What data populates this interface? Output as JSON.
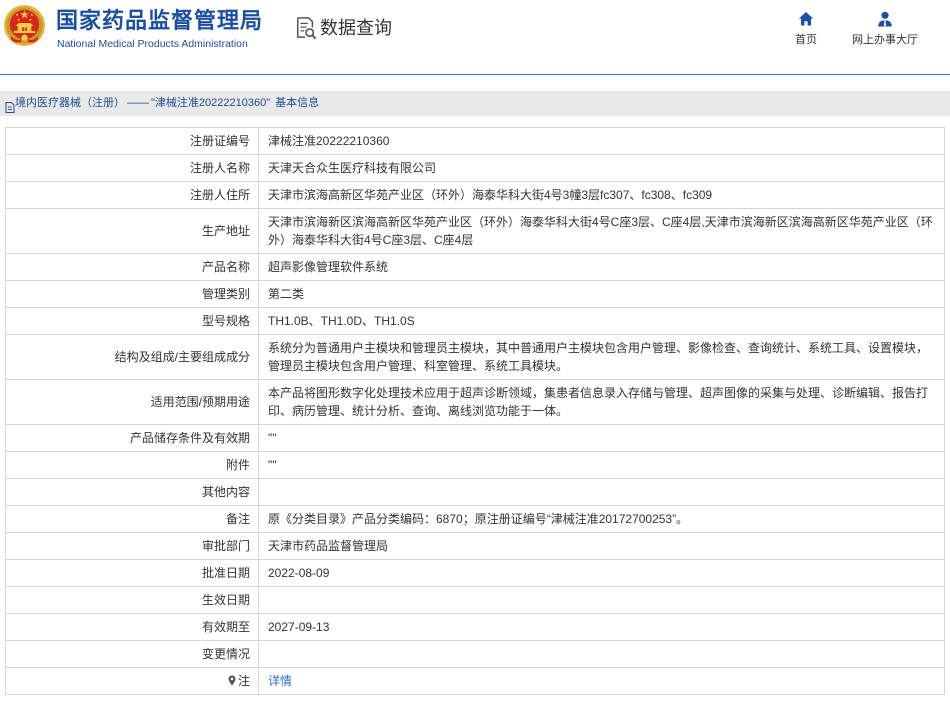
{
  "header": {
    "logo_icon": "national-emblem-icon",
    "title": "国家药品监督管理局",
    "subtitle": "National Medical Products Administration",
    "section_icon": "data-query-icon",
    "section_title": "数据查询"
  },
  "nav": [
    {
      "label": "首页",
      "icon": "home-icon"
    },
    {
      "label": "网上办事大厅",
      "icon": "user-icon"
    }
  ],
  "breadcrumb": {
    "icon": "document-icon",
    "category": "境内医疗器械（注册）",
    "separator": "——",
    "record": "\"津械注准20222210360\"",
    "suffix": "基本信息"
  },
  "table": {
    "rows": [
      {
        "label": "注册证编号",
        "value": "津械注准20222210360"
      },
      {
        "label": "注册人名称",
        "value": "天津天合众生医疗科技有限公司"
      },
      {
        "label": "注册人住所",
        "value": "天津市滨海高新区华苑产业区（环外）海泰华科大街4号3幢3层fc307、fc308、fc309"
      },
      {
        "label": "生产地址",
        "value": "天津市滨海新区滨海高新区华苑产业区（环外）海泰华科大街4号C座3层、C座4层,天津市滨海新区滨海高新区华苑产业区（环外）海泰华科大街4号C座3层、C座4层"
      },
      {
        "label": "产品名称",
        "value": "超声影像管理软件系统"
      },
      {
        "label": "管理类别",
        "value": "第二类"
      },
      {
        "label": "型号规格",
        "value": "TH1.0B、TH1.0D、TH1.0S"
      },
      {
        "label": "结构及组成/主要组成成分",
        "value": "系统分为普通用户主模块和管理员主模块，其中普通用户主模块包含用户管理、影像检查、查询统计、系统工具、设置模块，管理员主模块包含用户管理、科室管理、系统工具模块。"
      },
      {
        "label": "适用范围/预期用途",
        "value": "本产品将图形数字化处理技术应用于超声诊断领域，集患者信息录入存储与管理、超声图像的采集与处理、诊断编辑、报告打印、病历管理、统计分析、查询、离线浏览功能于一体。"
      },
      {
        "label": "产品储存条件及有效期",
        "value": "\"\""
      },
      {
        "label": "附件",
        "value": "\"\""
      },
      {
        "label": "其他内容",
        "value": ""
      },
      {
        "label": "备注",
        "value": "原《分类目录》产品分类编码：6870；原注册证编号“津械注准20172700253”。"
      },
      {
        "label": "审批部门",
        "value": "天津市药品监督管理局"
      },
      {
        "label": "批准日期",
        "value": "2022-08-09"
      },
      {
        "label": "生效日期",
        "value": ""
      },
      {
        "label": "有效期至",
        "value": "2027-09-13"
      },
      {
        "label": "变更情况",
        "value": ""
      },
      {
        "label": "注",
        "value": "详情",
        "icon": "pin-icon"
      }
    ]
  },
  "colors": {
    "brand_blue": "#1c4fa3",
    "rule_blue": "#3a74c8",
    "link_blue": "#2a6fca",
    "breadcrumb_bg": "#e9e9e9",
    "grid_border": "#d6d6d6",
    "text_dark": "#333333",
    "emblem_red": "#d7261e",
    "emblem_gold": "#e8b73a"
  }
}
